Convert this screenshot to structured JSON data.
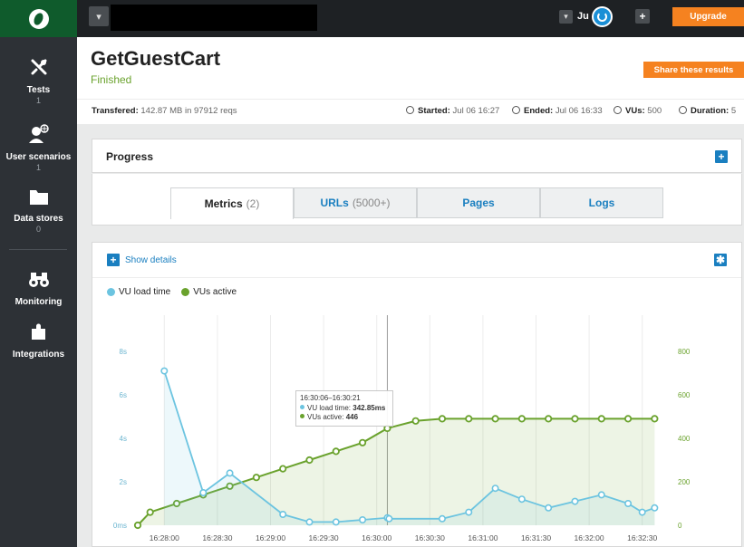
{
  "topbar": {
    "project_dropdown_icon": "chevron-down-icon",
    "project_name": "",
    "user_initials": "Ju",
    "upgrade_label": "Upgrade"
  },
  "sidebar": {
    "items": [
      {
        "label": "Tests",
        "count": "1",
        "icon": "tools-icon"
      },
      {
        "label": "User scenarios",
        "count": "1",
        "icon": "user-globe-icon"
      },
      {
        "label": "Data stores",
        "count": "0",
        "icon": "folder-icon"
      },
      {
        "label": "Monitoring",
        "count": "",
        "icon": "binoculars-icon"
      },
      {
        "label": "Integrations",
        "count": "",
        "icon": "puzzle-icon"
      }
    ]
  },
  "header": {
    "title": "GetGuestCart",
    "status": "Finished",
    "share_label": "Share these results",
    "transferred_label": "Transfered:",
    "transferred_value": "142.87 MB in 97912 reqs",
    "started_label": "Started:",
    "started_value": "Jul 06 16:27",
    "ended_label": "Ended:",
    "ended_value": "Jul 06 16:33",
    "vus_label": "VUs:",
    "vus_value": "500",
    "duration_label": "Duration:",
    "duration_value": "5"
  },
  "progress": {
    "title": "Progress"
  },
  "tabs": [
    {
      "label": "Metrics",
      "count": "(2)"
    },
    {
      "label": "URLs",
      "count": "(5000+)"
    },
    {
      "label": "Pages",
      "count": ""
    },
    {
      "label": "Logs",
      "count": ""
    }
  ],
  "chart_panel": {
    "show_details_label": "Show details"
  },
  "colors": {
    "vu_load_time": "#6cc4e0",
    "vus_active": "#6aa22d",
    "accent": "#f58220",
    "link": "#1a7fc0"
  },
  "chart_data": {
    "type": "line",
    "x": [
      "16:27:45",
      "16:27:52",
      "16:28:00",
      "16:28:07",
      "16:28:15",
      "16:28:22",
      "16:28:30",
      "16:28:37",
      "16:28:45",
      "16:28:52",
      "16:29:00",
      "16:29:07",
      "16:29:15",
      "16:29:22",
      "16:29:30",
      "16:29:37",
      "16:29:45",
      "16:29:52",
      "16:30:00",
      "16:30:07",
      "16:30:15",
      "16:30:22",
      "16:30:30",
      "16:30:37",
      "16:30:45",
      "16:30:52",
      "16:31:00",
      "16:31:07",
      "16:31:15",
      "16:31:22",
      "16:31:30",
      "16:31:37",
      "16:31:45",
      "16:31:52",
      "16:32:00",
      "16:32:07",
      "16:32:15",
      "16:32:22",
      "16:32:30"
    ],
    "x_ticks": [
      "16:28:00",
      "16:28:30",
      "16:29:00",
      "16:29:30",
      "16:30:00",
      "16:30:30",
      "16:31:00",
      "16:31:30",
      "16:32:00",
      "16:32:30"
    ],
    "series": [
      {
        "name": "VU load time",
        "axis": "left",
        "points": [
          [
            "16:28:00",
            7.1
          ],
          [
            "16:28:22",
            1.5
          ],
          [
            "16:28:37",
            2.4
          ],
          [
            "16:29:07",
            0.5
          ],
          [
            "16:29:22",
            0.15
          ],
          [
            "16:29:37",
            0.15
          ],
          [
            "16:29:52",
            0.25
          ],
          [
            "16:30:07",
            0.3
          ],
          [
            "16:30:06",
            0.34285
          ],
          [
            "16:30:37",
            0.3
          ],
          [
            "16:30:52",
            0.6
          ],
          [
            "16:31:07",
            1.7
          ],
          [
            "16:31:22",
            1.2
          ],
          [
            "16:31:37",
            0.8
          ],
          [
            "16:31:52",
            1.1
          ],
          [
            "16:32:07",
            1.4
          ],
          [
            "16:32:22",
            1.0
          ],
          [
            "16:32:30",
            0.6
          ],
          [
            "16:32:37",
            0.8
          ]
        ]
      },
      {
        "name": "VUs active",
        "axis": "right",
        "points": [
          [
            "16:27:45",
            0
          ],
          [
            "16:27:52",
            60
          ],
          [
            "16:28:07",
            100
          ],
          [
            "16:28:22",
            140
          ],
          [
            "16:28:37",
            180
          ],
          [
            "16:28:52",
            220
          ],
          [
            "16:29:07",
            260
          ],
          [
            "16:29:22",
            300
          ],
          [
            "16:29:37",
            340
          ],
          [
            "16:29:52",
            380
          ],
          [
            "16:30:06",
            446
          ],
          [
            "16:30:22",
            480
          ],
          [
            "16:30:37",
            490
          ],
          [
            "16:30:52",
            490
          ],
          [
            "16:31:07",
            490
          ],
          [
            "16:31:22",
            490
          ],
          [
            "16:31:37",
            490
          ],
          [
            "16:31:52",
            490
          ],
          [
            "16:32:07",
            490
          ],
          [
            "16:32:22",
            490
          ],
          [
            "16:32:37",
            490
          ]
        ]
      }
    ],
    "y_left_ticks": [
      "0ms",
      "2s",
      "4s",
      "6s",
      "8s"
    ],
    "y_right_ticks": [
      "0",
      "200",
      "400",
      "600",
      "800"
    ],
    "ylim_left": [
      0,
      8
    ],
    "ylim_right": [
      0,
      800
    ],
    "legend_position": "top-left",
    "grid": true,
    "tooltip": {
      "range": "16:30:06–16:30:21",
      "load_label": "VU load time:",
      "load_value": "342.85ms",
      "active_label": "VUs active:",
      "active_value": "446"
    }
  }
}
